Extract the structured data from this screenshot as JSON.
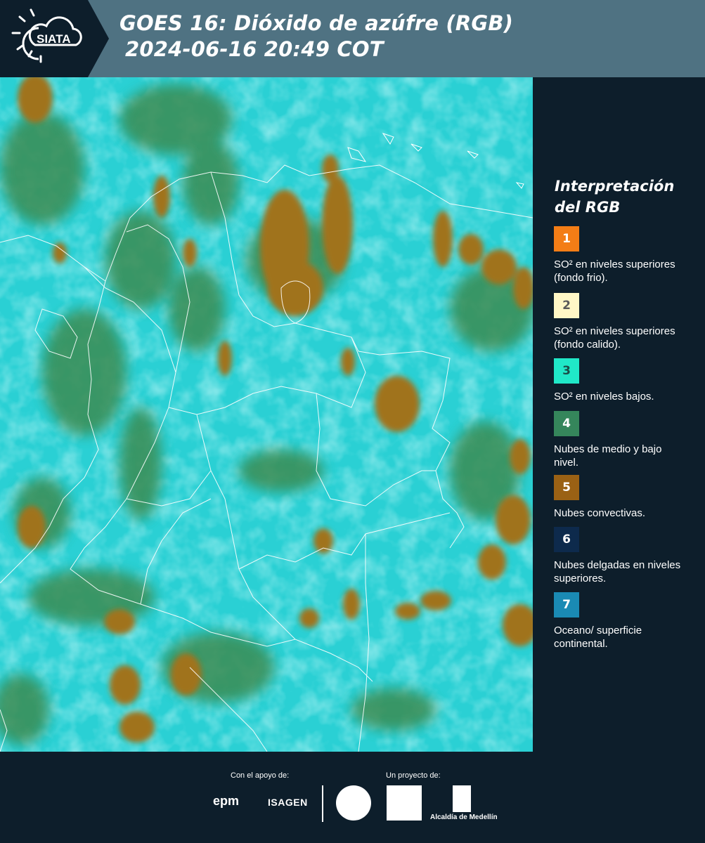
{
  "header": {
    "logo_text": "SIATA",
    "title_line1": "GOES 16: Dióxido de azúfre (RGB)",
    "title_line2": "2024-06-16 20:49 COT",
    "background_color": "#4f7282"
  },
  "legend": {
    "title": "Interpretación del RGB",
    "items": [
      {
        "number": "1",
        "color": "#f37d16",
        "text": "SO² en niveles superiores (fondo frio)."
      },
      {
        "number": "2",
        "color": "#fff7c6",
        "text": "SO² en niveles superiores (fondo calido)."
      },
      {
        "number": "3",
        "color": "#20e8c8",
        "text": "SO² en niveles bajos."
      },
      {
        "number": "4",
        "color": "#35865b",
        "text": "Nubes de medio y bajo nivel."
      },
      {
        "number": "5",
        "color": "#9a6114",
        "text": "Nubes convectivas."
      },
      {
        "number": "6",
        "color": "#0d2a4c",
        "text": "Nubes delgadas en niveles superiores."
      },
      {
        "number": "7",
        "color": "#1a8ab4",
        "text": "Oceano/ superficie continental."
      }
    ]
  },
  "footer": {
    "support_label": "Con el apoyo de:",
    "project_label": "Un proyecto de:",
    "sponsor1": "epm",
    "sponsor2": "ISAGEN",
    "partner3": "Alcaldía de Medellín"
  },
  "map": {
    "imagery_colors": {
      "cyan": "#2ad0d4",
      "green": "#3f8a4c",
      "brown": "#a0731f",
      "border": "#ffffff"
    }
  }
}
